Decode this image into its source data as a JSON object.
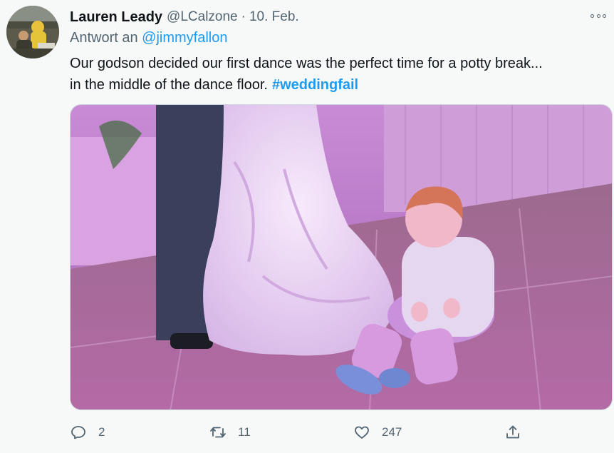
{
  "tweet": {
    "display_name": "Lauren Leady",
    "handle": "@LCalzone",
    "separator": "·",
    "date": "10. Feb.",
    "reply_prefix": "Antwort an",
    "reply_mention": "@jimmyfallon",
    "text_line1": "Our godson decided our first dance was the perfect time for a potty break...",
    "text_line2": "in the middle of the dance floor.",
    "hashtag": "#weddingfail"
  },
  "actions": {
    "reply_count": "2",
    "retweet_count": "11",
    "like_count": "247"
  },
  "icons": {
    "more": "more-horizontal-icon",
    "reply": "reply-bubble-icon",
    "retweet": "retweet-arrows-icon",
    "like": "heart-icon",
    "share": "share-upload-icon"
  },
  "colors": {
    "accent": "#1d9bf0",
    "secondary_text": "#536471",
    "primary_text": "#0f1419",
    "background": "#f7f9f9"
  }
}
